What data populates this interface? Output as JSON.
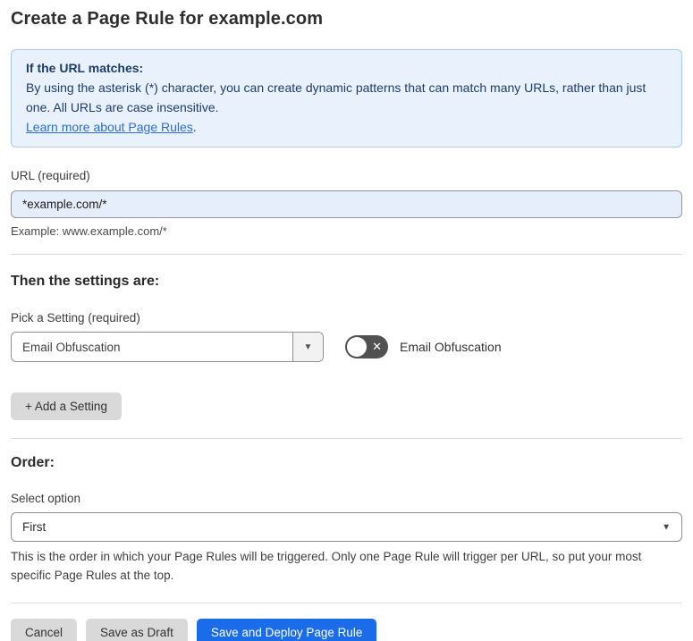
{
  "page": {
    "title": "Create a Page Rule for example.com"
  },
  "info_box": {
    "heading": "If the URL matches:",
    "body": "By using the asterisk (*) character, you can create dynamic patterns that can match many URLs, rather than just one. All URLs are case insensitive.",
    "link_text": "Learn more about Page Rules",
    "link_suffix": "."
  },
  "url_field": {
    "label": "URL (required)",
    "value": "*example.com/*",
    "helper": "Example: www.example.com/*"
  },
  "settings_section": {
    "heading": "Then the settings are:",
    "picker_label": "Pick a Setting (required)",
    "picker_value": "Email Obfuscation",
    "picker_arrow_icon": "▼",
    "toggle_state": "off",
    "toggle_x_icon": "✕",
    "toggle_label": "Email Obfuscation",
    "add_button_label": "+ Add a Setting"
  },
  "order_section": {
    "heading": "Order:",
    "select_label": "Select option",
    "select_value": "First",
    "select_chevron_icon": "▼",
    "helper": "This is the order in which your Page Rules will be triggered. Only one Page Rule will trigger per URL, so put your most specific Page Rules at the top."
  },
  "footer": {
    "cancel_label": "Cancel",
    "save_draft_label": "Save as Draft",
    "save_deploy_label": "Save and Deploy Page Rule"
  },
  "colors": {
    "info_bg": "#e9f2fc",
    "info_border": "#aacaeb",
    "info_text": "#1e3c68",
    "link": "#2b6cd4",
    "input_bg": "#e7eefb",
    "accent_blue": "#1a6ce8",
    "button_gray": "#d9d9d9",
    "toggle_bg": "#515151"
  }
}
